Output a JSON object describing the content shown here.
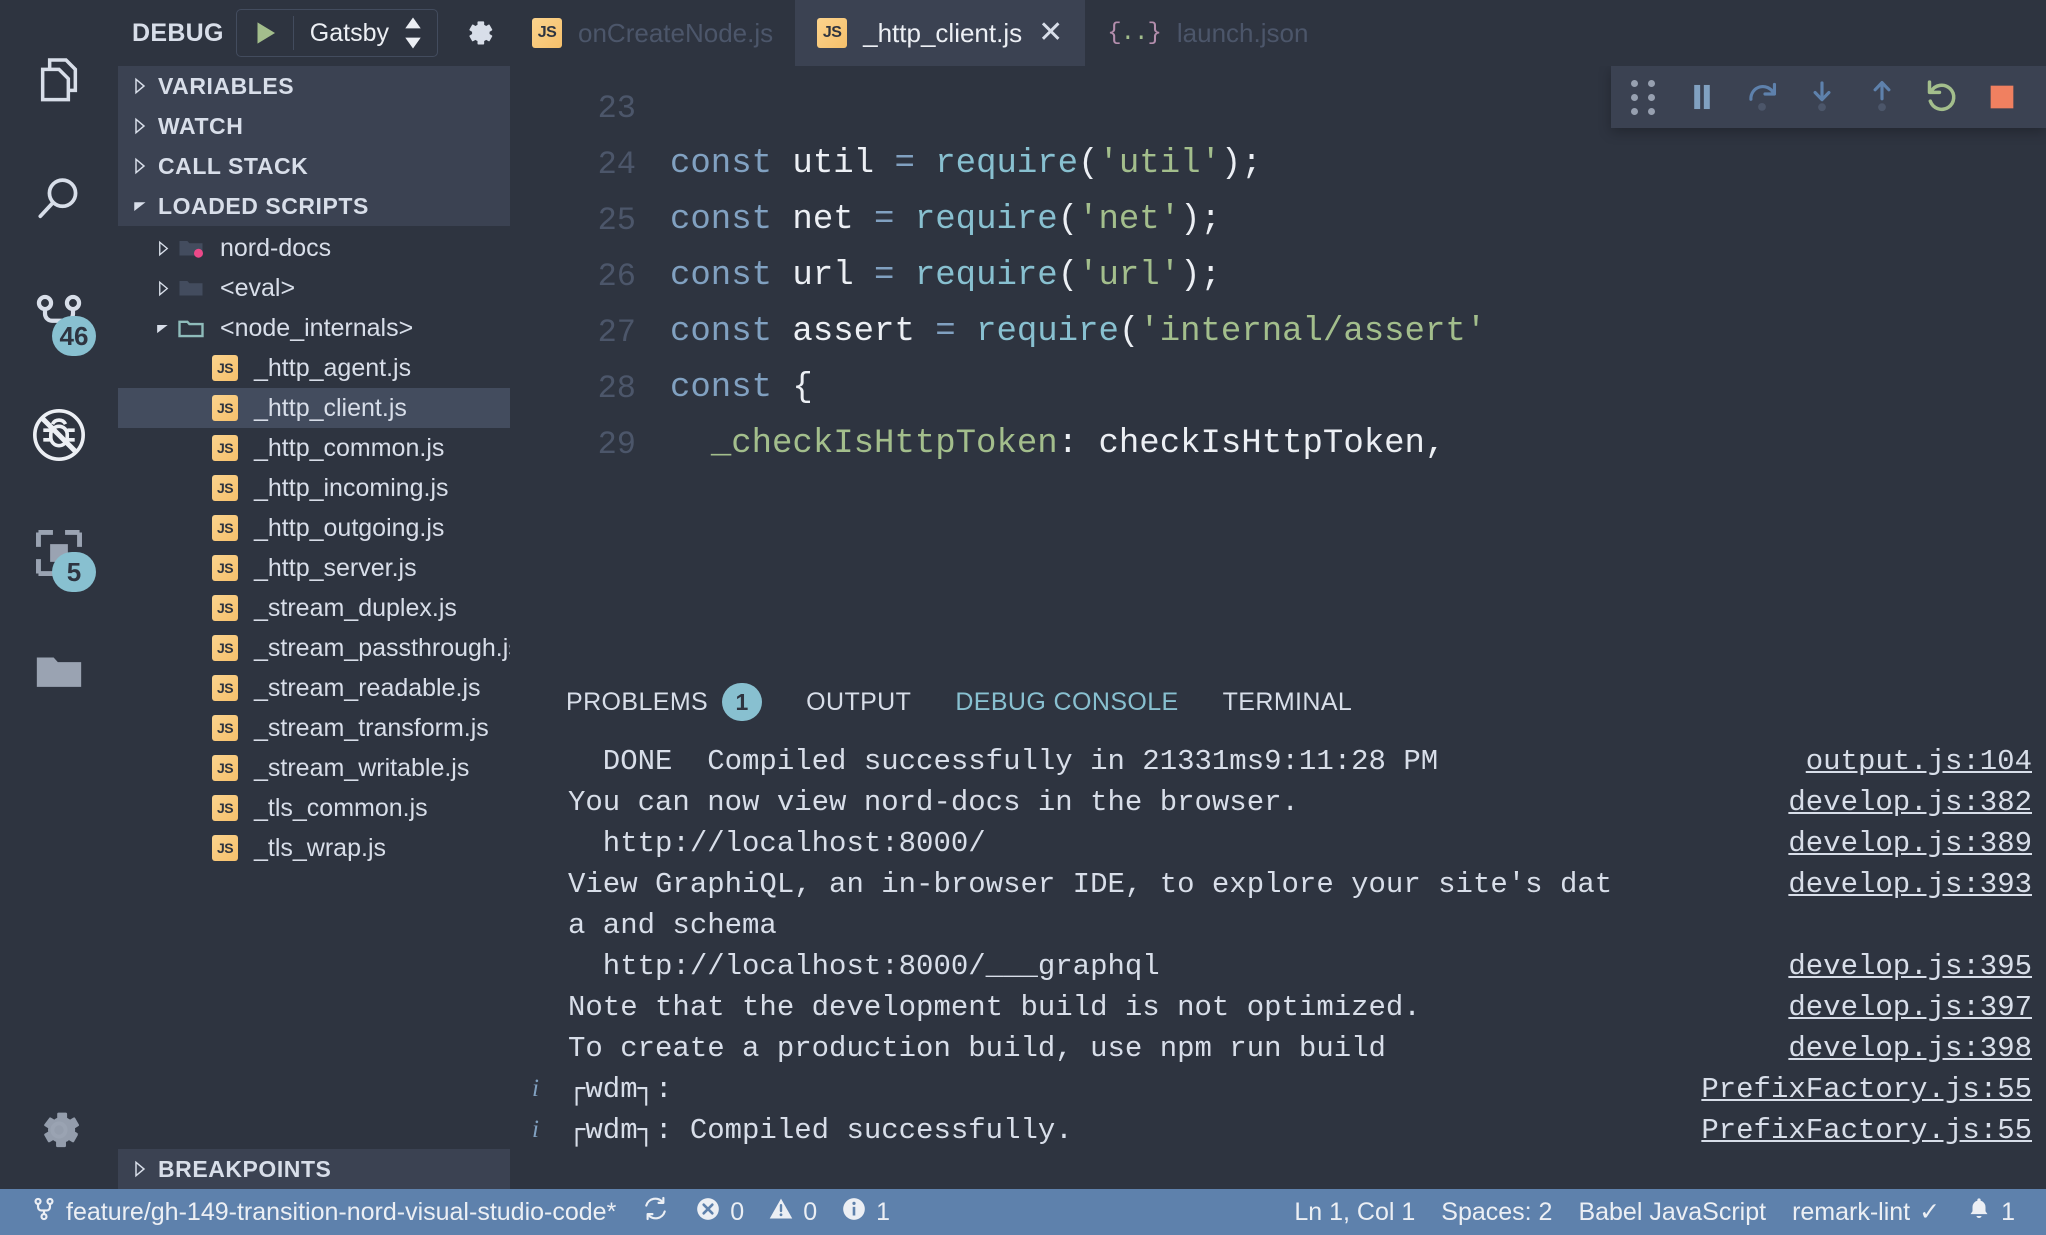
{
  "activity_bar": {
    "items": [
      {
        "name": "explorer",
        "icon": "files-icon",
        "badge": null
      },
      {
        "name": "search",
        "icon": "search-icon",
        "badge": null
      },
      {
        "name": "source-control",
        "icon": "source-control-icon",
        "badge": "46"
      },
      {
        "name": "run-and-debug",
        "icon": "debug-alt-icon",
        "badge": null
      },
      {
        "name": "extensions",
        "icon": "extensions-icon",
        "badge": "5"
      },
      {
        "name": "remote-explorer",
        "icon": "folder-icon",
        "badge": null
      }
    ],
    "manage": {
      "name": "manage",
      "icon": "gear-icon"
    }
  },
  "debug_header": {
    "label": "DEBUG",
    "configuration": "Gatsby",
    "play_icon": "play-icon",
    "settings_icon": "gear-icon",
    "console_icon": "open-debug-console-icon"
  },
  "sidebar": {
    "sections": [
      {
        "label": "VARIABLES",
        "expanded": false
      },
      {
        "label": "WATCH",
        "expanded": false
      },
      {
        "label": "CALL STACK",
        "expanded": false
      },
      {
        "label": "LOADED SCRIPTS",
        "expanded": true
      }
    ],
    "breakpoints_label": "BREAKPOINTS",
    "tree": [
      {
        "label": "nord-docs",
        "type": "folder",
        "indent": 1,
        "expanded": false,
        "modified": true,
        "selected": false
      },
      {
        "label": "<eval>",
        "type": "folder",
        "indent": 1,
        "expanded": false,
        "modified": false,
        "selected": false
      },
      {
        "label": "<node_internals>",
        "type": "folder-open",
        "indent": 1,
        "expanded": true,
        "modified": false,
        "selected": false
      },
      {
        "label": "_http_agent.js",
        "type": "js",
        "indent": 2,
        "selected": false
      },
      {
        "label": "_http_client.js",
        "type": "js",
        "indent": 2,
        "selected": true
      },
      {
        "label": "_http_common.js",
        "type": "js",
        "indent": 2,
        "selected": false
      },
      {
        "label": "_http_incoming.js",
        "type": "js",
        "indent": 2,
        "selected": false
      },
      {
        "label": "_http_outgoing.js",
        "type": "js",
        "indent": 2,
        "selected": false
      },
      {
        "label": "_http_server.js",
        "type": "js",
        "indent": 2,
        "selected": false
      },
      {
        "label": "_stream_duplex.js",
        "type": "js",
        "indent": 2,
        "selected": false
      },
      {
        "label": "_stream_passthrough.js",
        "type": "js",
        "indent": 2,
        "selected": false
      },
      {
        "label": "_stream_readable.js",
        "type": "js",
        "indent": 2,
        "selected": false
      },
      {
        "label": "_stream_transform.js",
        "type": "js",
        "indent": 2,
        "selected": false
      },
      {
        "label": "_stream_writable.js",
        "type": "js",
        "indent": 2,
        "selected": false
      },
      {
        "label": "_tls_common.js",
        "type": "js",
        "indent": 2,
        "selected": false
      },
      {
        "label": "_tls_wrap.js",
        "type": "js",
        "indent": 2,
        "selected": false
      }
    ]
  },
  "tabs": [
    {
      "label": "onCreateNode.js",
      "icon": "js-icon",
      "active": false,
      "closable": false
    },
    {
      "label": "_http_client.js",
      "icon": "js-icon",
      "active": true,
      "closable": true,
      "close_glyph": "✕"
    },
    {
      "label": "launch.json",
      "icon": "json-icon",
      "active": false,
      "closable": false
    }
  ],
  "debug_toolbar": {
    "buttons": [
      {
        "name": "drag-handle",
        "icon": "grip-icon"
      },
      {
        "name": "pause-button",
        "icon": "pause-icon",
        "color": "#81A1C1"
      },
      {
        "name": "step-over-button",
        "icon": "step-over-icon",
        "color": "#5E81AC"
      },
      {
        "name": "step-into-button",
        "icon": "step-into-icon",
        "color": "#5E81AC"
      },
      {
        "name": "step-out-button",
        "icon": "step-out-icon",
        "color": "#5E81AC"
      },
      {
        "name": "restart-button",
        "icon": "restart-icon",
        "color": "#A3BE8C"
      },
      {
        "name": "stop-button",
        "icon": "stop-icon",
        "color": "#F08060"
      }
    ]
  },
  "editor": {
    "lines": [
      {
        "num": "23",
        "tokens": []
      },
      {
        "num": "24",
        "tokens": [
          {
            "t": "const ",
            "c": "kw"
          },
          {
            "t": "util",
            "c": "var"
          },
          {
            "t": " ",
            "c": "punc"
          },
          {
            "t": "=",
            "c": "kw"
          },
          {
            "t": " ",
            "c": "punc"
          },
          {
            "t": "require",
            "c": "fn"
          },
          {
            "t": "(",
            "c": "punc"
          },
          {
            "t": "'util'",
            "c": "str"
          },
          {
            "t": ");",
            "c": "punc"
          }
        ]
      },
      {
        "num": "25",
        "tokens": [
          {
            "t": "const ",
            "c": "kw"
          },
          {
            "t": "net",
            "c": "var"
          },
          {
            "t": " ",
            "c": "punc"
          },
          {
            "t": "=",
            "c": "kw"
          },
          {
            "t": " ",
            "c": "punc"
          },
          {
            "t": "require",
            "c": "fn"
          },
          {
            "t": "(",
            "c": "punc"
          },
          {
            "t": "'net'",
            "c": "str"
          },
          {
            "t": ");",
            "c": "punc"
          }
        ]
      },
      {
        "num": "26",
        "tokens": [
          {
            "t": "const ",
            "c": "kw"
          },
          {
            "t": "url",
            "c": "var"
          },
          {
            "t": " ",
            "c": "punc"
          },
          {
            "t": "=",
            "c": "kw"
          },
          {
            "t": " ",
            "c": "punc"
          },
          {
            "t": "require",
            "c": "fn"
          },
          {
            "t": "(",
            "c": "punc"
          },
          {
            "t": "'url'",
            "c": "str"
          },
          {
            "t": ");",
            "c": "punc"
          }
        ]
      },
      {
        "num": "27",
        "tokens": [
          {
            "t": "const ",
            "c": "kw"
          },
          {
            "t": "assert",
            "c": "var"
          },
          {
            "t": " ",
            "c": "punc"
          },
          {
            "t": "=",
            "c": "kw"
          },
          {
            "t": " ",
            "c": "punc"
          },
          {
            "t": "require",
            "c": "fn"
          },
          {
            "t": "(",
            "c": "punc"
          },
          {
            "t": "'internal/assert'",
            "c": "str"
          }
        ]
      },
      {
        "num": "28",
        "tokens": [
          {
            "t": "const ",
            "c": "kw"
          },
          {
            "t": "{",
            "c": "punc"
          }
        ]
      },
      {
        "num": "29",
        "tokens": [
          {
            "t": "  ",
            "c": "punc"
          },
          {
            "t": "_checkIsHttpToken",
            "c": "prop"
          },
          {
            "t": ": ",
            "c": "punc"
          },
          {
            "t": "checkIsHttpToken",
            "c": "var"
          },
          {
            "t": ",",
            "c": "punc"
          }
        ]
      }
    ]
  },
  "panel": {
    "tabs": [
      {
        "label": "PROBLEMS",
        "badge": "1",
        "active": false
      },
      {
        "label": "OUTPUT",
        "badge": null,
        "active": false
      },
      {
        "label": "DEBUG CONSOLE",
        "badge": null,
        "active": true
      },
      {
        "label": "TERMINAL",
        "badge": null,
        "active": false
      }
    ],
    "console_lines": [
      {
        "text": "  DONE  Compiled successfully in 21331ms9:11:28 PM",
        "source": "output.js:104",
        "info": false
      },
      {
        "text": "You can now view nord-docs in the browser.",
        "source": "develop.js:382",
        "info": false
      },
      {
        "text": "  http://localhost:8000/",
        "source": "develop.js:389",
        "info": false
      },
      {
        "text": "View GraphiQL, an in-browser IDE, to explore your site's dat",
        "source": "develop.js:393",
        "info": false
      },
      {
        "text": "a and schema",
        "source": "",
        "info": false
      },
      {
        "text": "  http://localhost:8000/___graphql",
        "source": "develop.js:395",
        "info": false
      },
      {
        "text": "Note that the development build is not optimized.",
        "source": "develop.js:397",
        "info": false
      },
      {
        "text": "To create a production build, use npm run build",
        "source": "develop.js:398",
        "info": false
      },
      {
        "text": "┌wdm┐:",
        "source": "PrefixFactory.js:55",
        "info": true
      },
      {
        "text": "┌wdm┐: Compiled successfully.",
        "source": "PrefixFactory.js:55",
        "info": true
      }
    ]
  },
  "status_bar": {
    "branch": "feature/gh-149-transition-nord-visual-studio-code*",
    "branch_icon": "source-control-icon",
    "sync_icon": "sync-icon",
    "errors": "0",
    "warnings": "0",
    "infos": "1",
    "cursor": "Ln 1, Col 1",
    "spaces": "Spaces: 2",
    "language": "Babel JavaScript",
    "linter": "remark-lint",
    "linter_check": "✓",
    "notifications": "1",
    "bell_icon": "bell-icon"
  },
  "colors": {
    "bg": "#2E3440",
    "bg_alt": "#3B4252",
    "selection": "#434C5E",
    "accent": "#88C0D0",
    "status_bar": "#5E81AC",
    "green": "#A3BE8C",
    "red": "#BF616A",
    "pink": "#B48EAD",
    "stop": "#F08060",
    "text": "#D8DEE9"
  }
}
